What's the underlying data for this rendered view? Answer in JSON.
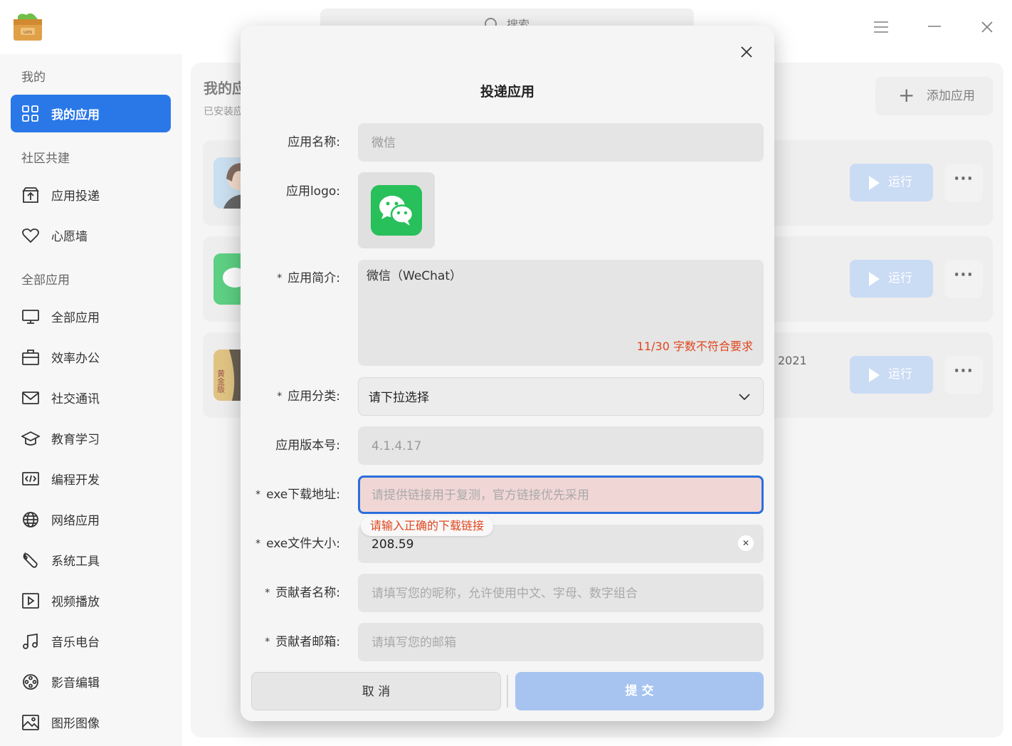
{
  "titlebar": {
    "logo_text": "uos",
    "search_placeholder": "搜索"
  },
  "sidebar": {
    "sections": [
      "我的",
      "社区共建",
      "全部应用"
    ],
    "items": [
      {
        "label": "我的应用",
        "icon": "grid-icon",
        "active": true
      },
      {
        "label": "应用投递",
        "icon": "upload-box-icon"
      },
      {
        "label": "心愿墙",
        "icon": "heart-icon"
      },
      {
        "label": "全部应用",
        "icon": "monitor-icon"
      },
      {
        "label": "效率办公",
        "icon": "briefcase-icon"
      },
      {
        "label": "社交通讯",
        "icon": "mail-icon"
      },
      {
        "label": "教育学习",
        "icon": "graduation-cap-icon"
      },
      {
        "label": "编程开发",
        "icon": "code-icon"
      },
      {
        "label": "网络应用",
        "icon": "globe-icon"
      },
      {
        "label": "系统工具",
        "icon": "wrench-icon"
      },
      {
        "label": "视频播放",
        "icon": "play-box-icon"
      },
      {
        "label": "音乐电台",
        "icon": "music-note-icon"
      },
      {
        "label": "影音编辑",
        "icon": "film-reel-icon"
      },
      {
        "label": "图形图像",
        "icon": "image-icon"
      }
    ]
  },
  "main": {
    "title": "我的应",
    "subtitle": "已安装应",
    "add_button": "添加应用",
    "cards": [
      {
        "run_label": "运行",
        "more_label": "···",
        "extra": ""
      },
      {
        "run_label": "运行",
        "more_label": "···",
        "extra": ""
      },
      {
        "run_label": "运行",
        "more_label": "···",
        "extra": "2021",
        "icon_text": "黄金版"
      }
    ]
  },
  "dialog": {
    "title": "投递应用",
    "fields": {
      "app_name": {
        "label": "应用名称:",
        "value": "微信"
      },
      "app_logo": {
        "label": "应用logo:"
      },
      "app_intro": {
        "label": "应用简介:",
        "value": "微信（WeChat）",
        "error": "11/30 字数不符合要求"
      },
      "app_category": {
        "label": "应用分类:",
        "value": "请下拉选择"
      },
      "app_version": {
        "label": "应用版本号:",
        "value": "4.1.4.17"
      },
      "exe_url": {
        "label": "exe下载地址:",
        "placeholder": "请提供链接用于复测，官方链接优先采用",
        "error": "请输入正确的下载链接"
      },
      "exe_size": {
        "label": "exe文件大小:",
        "value": "208.59"
      },
      "contributor_name": {
        "label": "贡献者名称:",
        "placeholder": "请填写您的昵称，允许使用中文、字母、数字组合"
      },
      "contributor_email": {
        "label": "贡献者邮箱:",
        "placeholder": "请填写您的邮箱"
      }
    },
    "required_mark": "*",
    "cancel": "取 消",
    "submit": "提 交",
    "colors": {
      "accent": "#2a78e8",
      "error": "#e0461e",
      "submit_disabled": "#a6c4ef"
    }
  }
}
